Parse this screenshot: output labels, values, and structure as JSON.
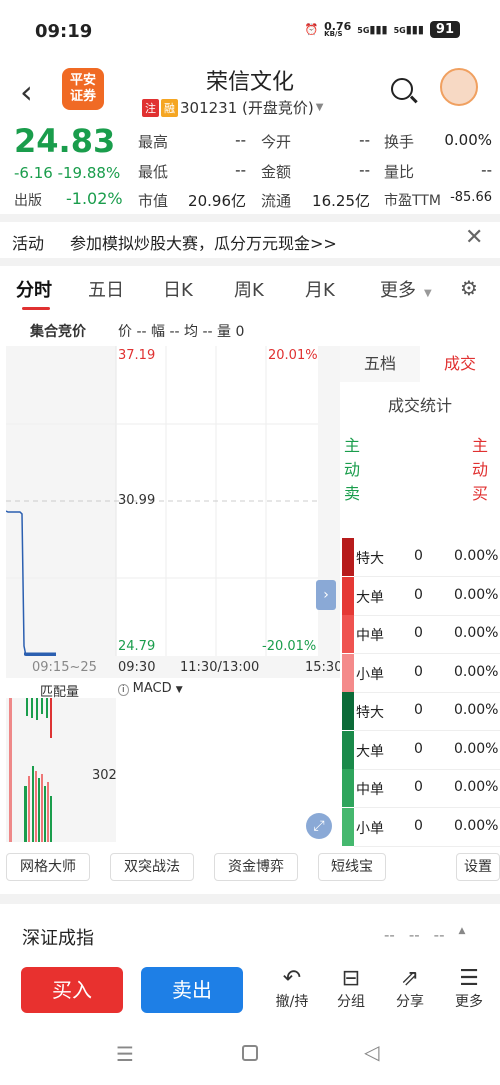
{
  "status": {
    "time": "09:19",
    "net": "0.76",
    "net_unit": "KB/S",
    "sig1": "5G",
    "sig2": "5G",
    "battery": "91"
  },
  "header": {
    "back": "<",
    "logo_line1": "平安",
    "logo_line2": "证券",
    "name": "荣信文化",
    "tag1": "注",
    "tag2": "融",
    "code": "301231 (开盘竞价)"
  },
  "quote": {
    "price": "24.83",
    "change": "-6.16",
    "change_pct": "-19.88%",
    "board_label": "出版",
    "board_pct": "-1.02%",
    "rows": [
      [
        [
          "最高",
          "--"
        ],
        [
          "今开",
          "--"
        ],
        [
          "换手",
          "0.00%"
        ]
      ],
      [
        [
          "最低",
          "--"
        ],
        [
          "金额",
          "--"
        ],
        [
          "量比",
          "--"
        ]
      ],
      [
        [
          "市值",
          "20.96亿"
        ],
        [
          "流通",
          "16.25亿"
        ],
        [
          "市盈TTM",
          "-85.66"
        ]
      ]
    ]
  },
  "activity": {
    "label": "活动",
    "text": "参加模拟炒股大赛，瓜分万元现金>>"
  },
  "tabs": [
    "分时",
    "五日",
    "日K",
    "周K",
    "月K",
    "更多"
  ],
  "chart": {
    "legend": "集合竞价",
    "legend2": "价 -- 幅 -- 均 -- 量 0",
    "y_top": "37.19",
    "y_mid": "30.99",
    "y_bot": "24.79",
    "pct_top": "20.01%",
    "pct_bot": "-20.01%",
    "x_labels": [
      "09:15~25",
      "09:30",
      "11:30/13:00",
      "15:30"
    ],
    "sub_left": "匹配量",
    "sub_right": "MACD",
    "sub_val": "302"
  },
  "panel": {
    "tab1": "五档",
    "tab2": "成交",
    "title": "成交统计",
    "sell": "主动卖",
    "buy": "主动买",
    "rows": [
      [
        "特大",
        "0",
        "0.00%"
      ],
      [
        "大单",
        "0",
        "0.00%"
      ],
      [
        "中单",
        "0",
        "0.00%"
      ],
      [
        "小单",
        "0",
        "0.00%"
      ],
      [
        "特大",
        "0",
        "0.00%"
      ],
      [
        "大单",
        "0",
        "0.00%"
      ],
      [
        "中单",
        "0",
        "0.00%"
      ],
      [
        "小单",
        "0",
        "0.00%"
      ]
    ]
  },
  "tools": [
    "网格大师",
    "双突战法",
    "资金博弈",
    "短线宝",
    "设置"
  ],
  "index": {
    "name": "深证成指",
    "v1": "--",
    "v2": "--",
    "v3": "--"
  },
  "bottom": {
    "buy": "买入",
    "sell": "卖出",
    "b1": "撤/持",
    "b2": "分组",
    "b3": "分享",
    "b4": "更多"
  },
  "colors": {
    "up": "#e03131",
    "down": "#1a9d4c",
    "buy_btn": "#e8312f",
    "sell_btn": "#1e7fe6"
  }
}
